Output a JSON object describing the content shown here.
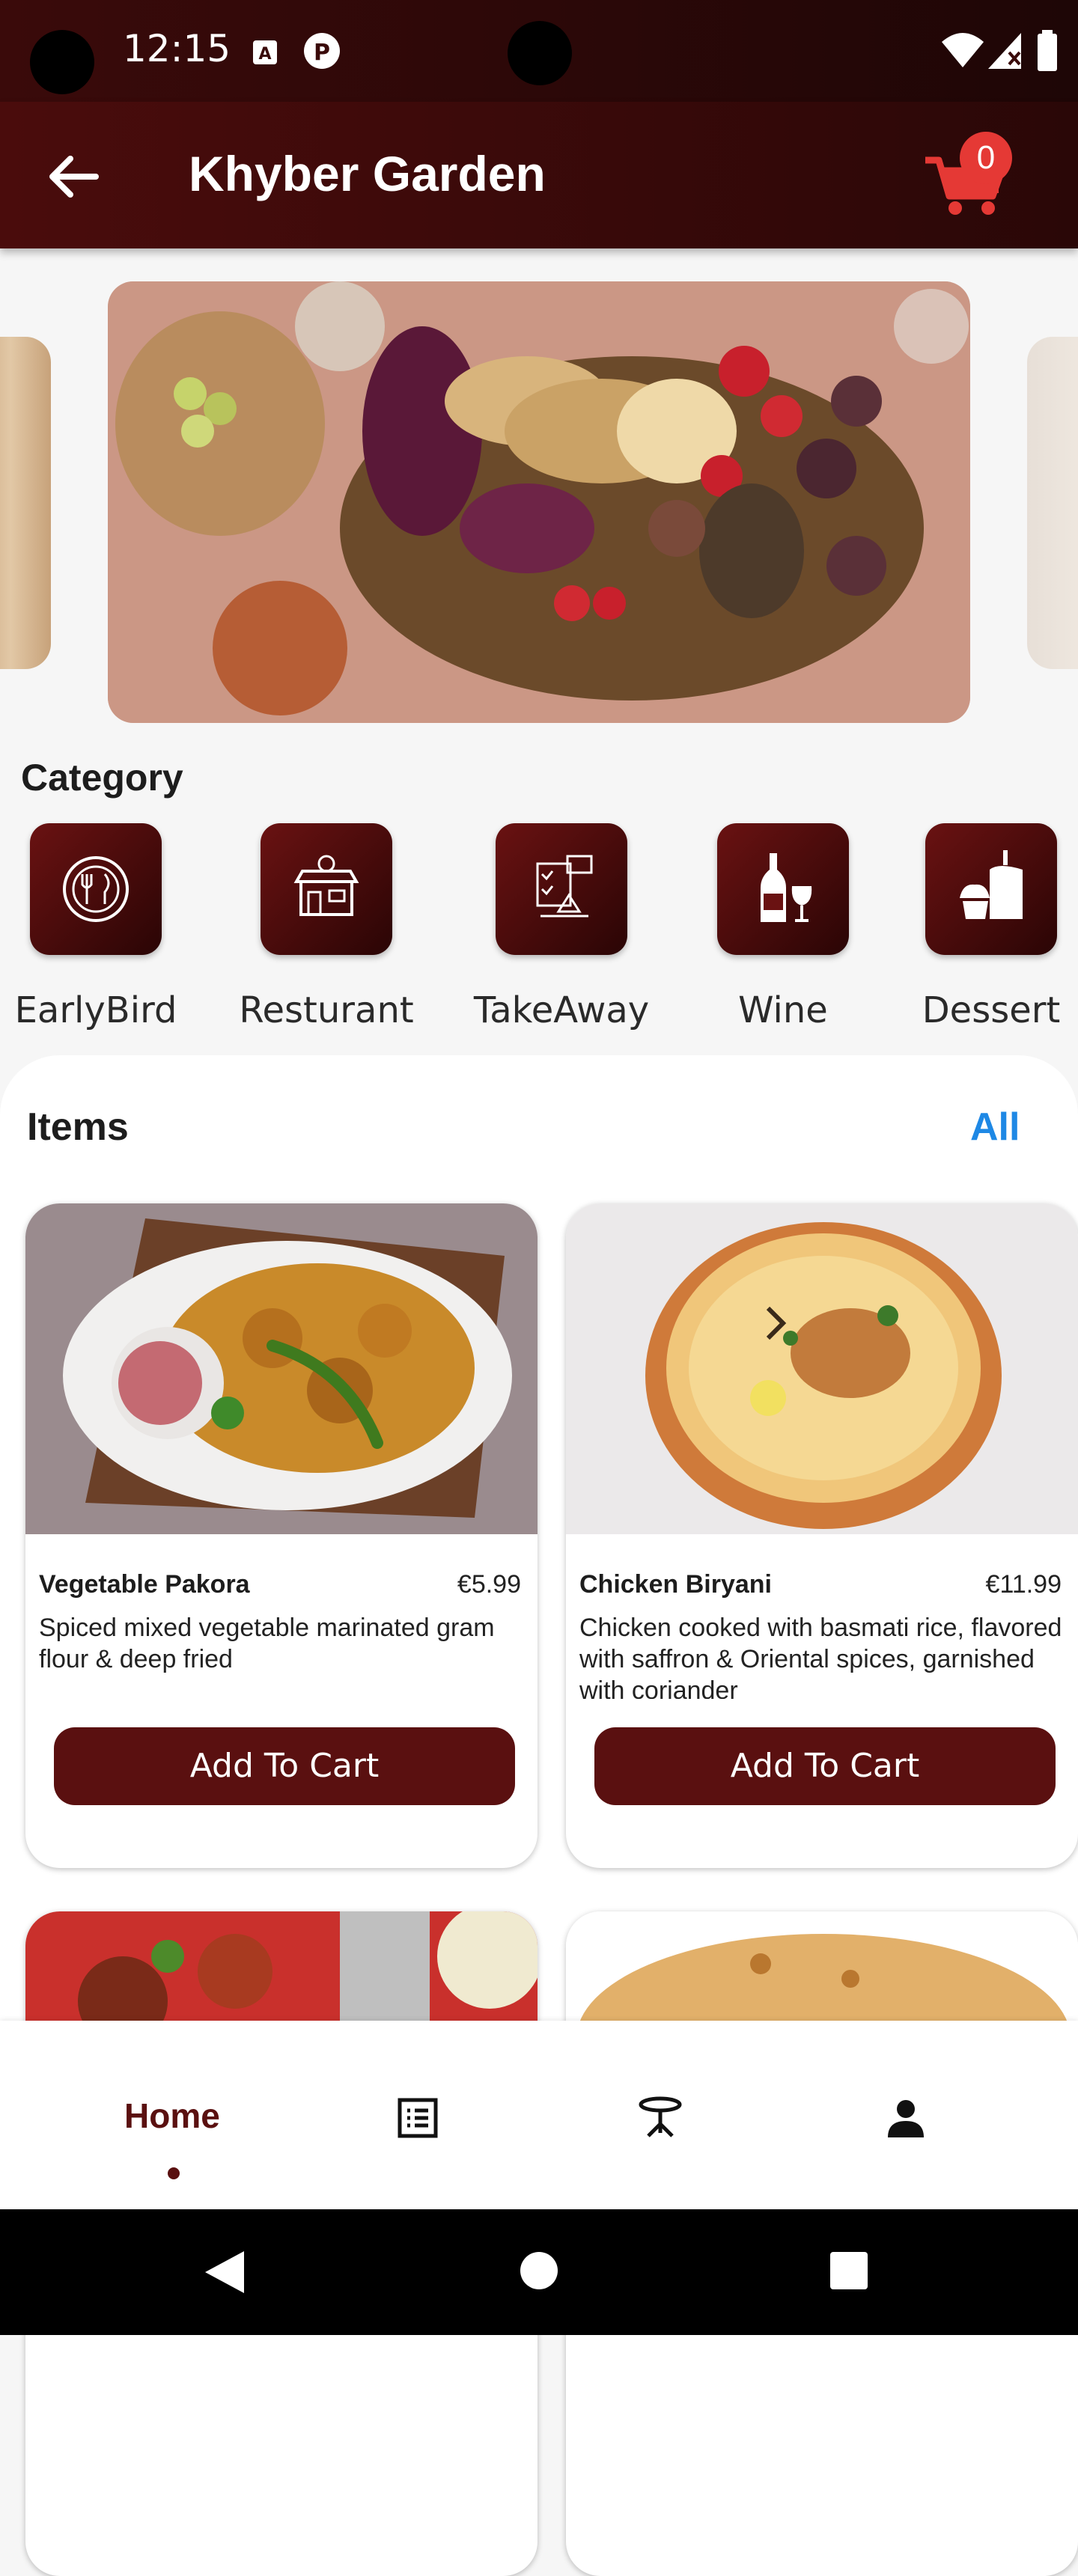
{
  "status": {
    "time": "12:15"
  },
  "appbar": {
    "title": "Khyber Garden",
    "cart_count": "0"
  },
  "category": {
    "title": "Category",
    "items": [
      {
        "label": "EarlyBird",
        "icon": "plate-cutlery-icon"
      },
      {
        "label": "Resturant",
        "icon": "restaurant-icon"
      },
      {
        "label": "TakeAway",
        "icon": "takeaway-icon"
      },
      {
        "label": "Wine",
        "icon": "wine-icon"
      },
      {
        "label": "Dessert",
        "icon": "cake-icon"
      }
    ]
  },
  "items": {
    "title": "Items",
    "all_label": "All",
    "products": [
      {
        "name": "Vegetable Pakora",
        "price": "€5.99",
        "description": "Spiced mixed vegetable marinated gram flour & deep fried",
        "button": "Add To Cart"
      },
      {
        "name": "Chicken Biryani",
        "price": "€11.99",
        "description": "Chicken cooked with basmati rice, flavored with saffron & Oriental spices, garnished with coriander",
        "button": "Add To Cart"
      }
    ]
  },
  "nav": {
    "home_label": "Home"
  },
  "colors": {
    "primary": "#5a1010",
    "accent": "#1e88e5",
    "badge": "#e53935"
  }
}
